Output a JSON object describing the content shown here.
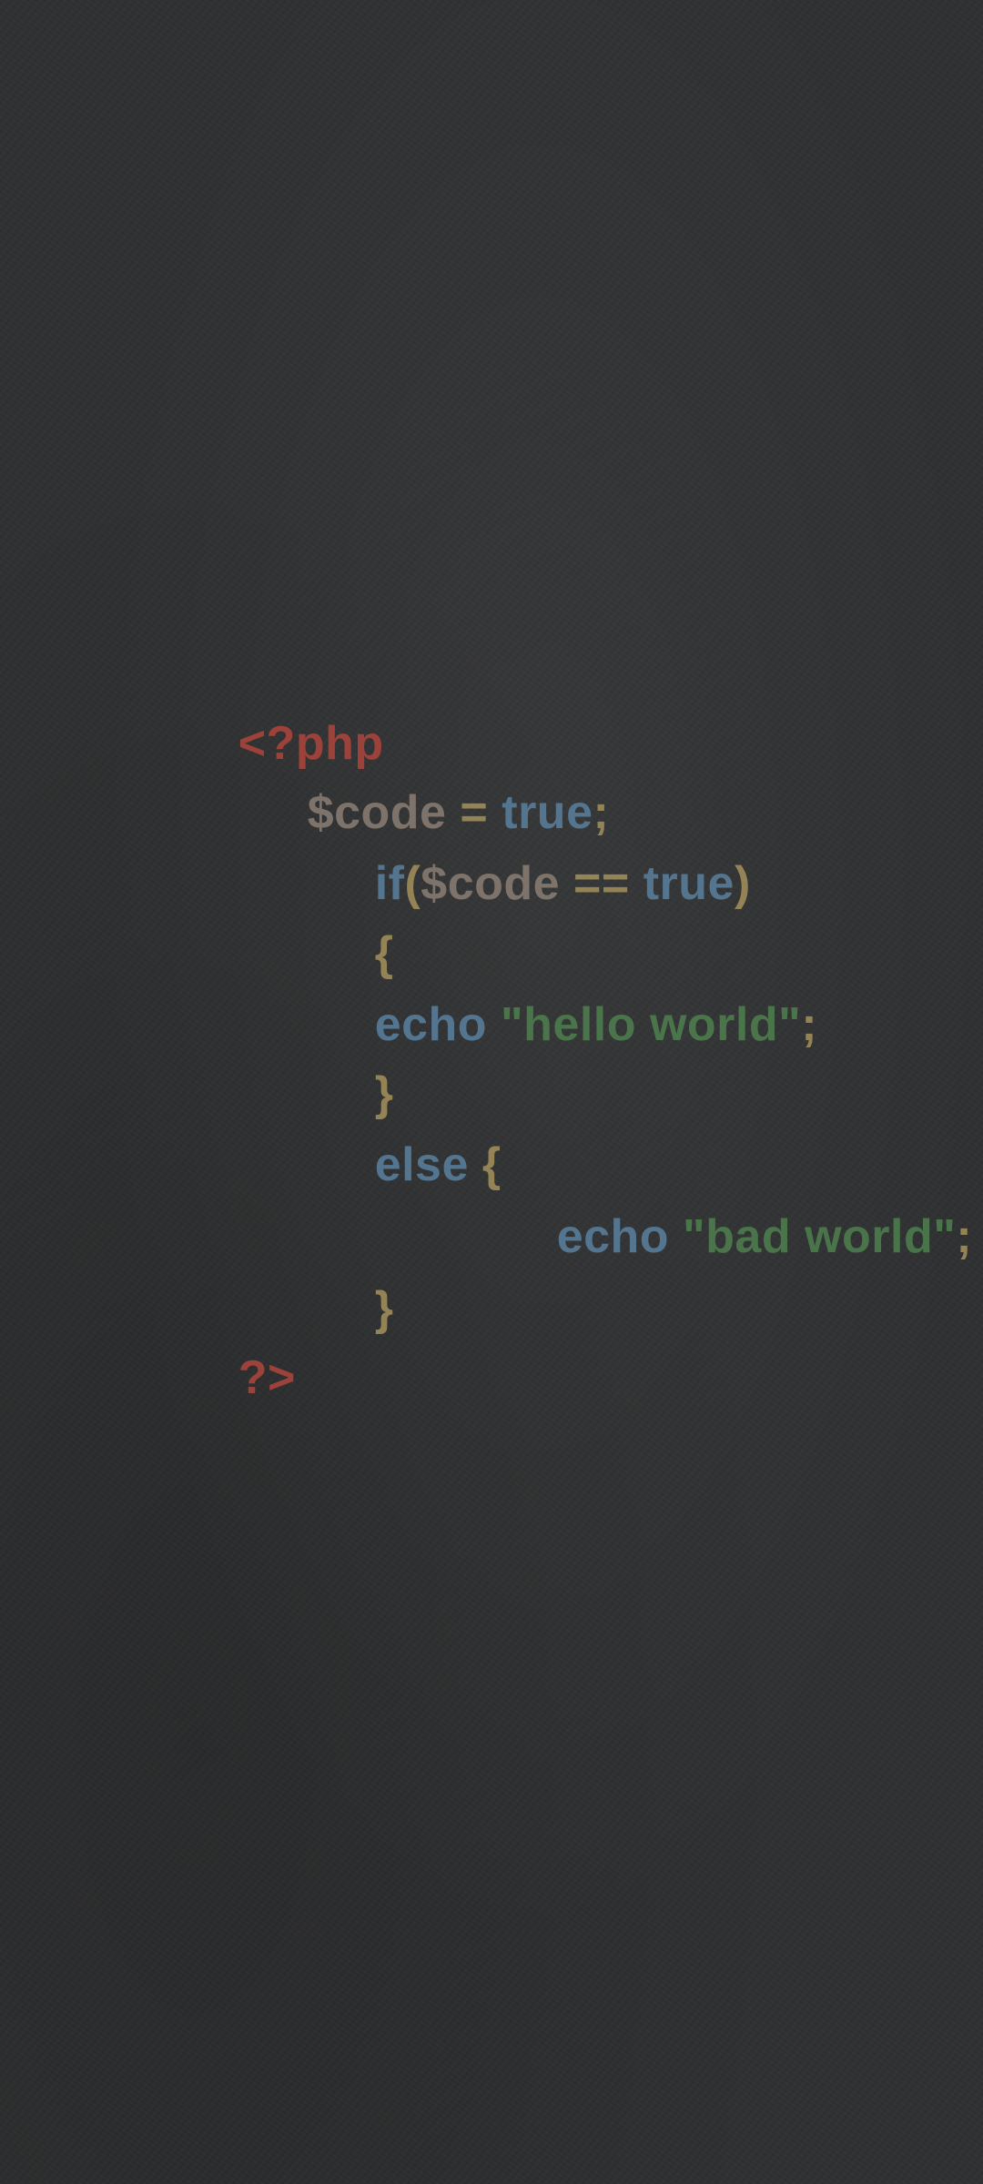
{
  "colors": {
    "background": "#2f3031",
    "tag": "#a6443b",
    "variable": "#85796f",
    "keyword": "#577b98",
    "punctuation": "#9c8a58",
    "string": "#4c7a4c"
  },
  "code": {
    "open_tag": "<?php",
    "line2": {
      "variable": "$code",
      "assign": " = ",
      "value": "true",
      "semicolon": ";"
    },
    "line3": {
      "keyword": "if",
      "paren_open": "(",
      "variable": "$code",
      "operator": " == ",
      "value": "true",
      "paren_close": ")"
    },
    "line4": {
      "brace": "{"
    },
    "line5": {
      "keyword": "echo ",
      "string": "\"hello world\"",
      "semicolon": ";"
    },
    "line6": {
      "brace": "}"
    },
    "line7": {
      "keyword": "else ",
      "brace": "{"
    },
    "line8": {
      "keyword": "echo ",
      "string": "\"bad world\"",
      "semicolon": ";"
    },
    "line9": {
      "brace": "}"
    },
    "close_tag": "?>"
  }
}
